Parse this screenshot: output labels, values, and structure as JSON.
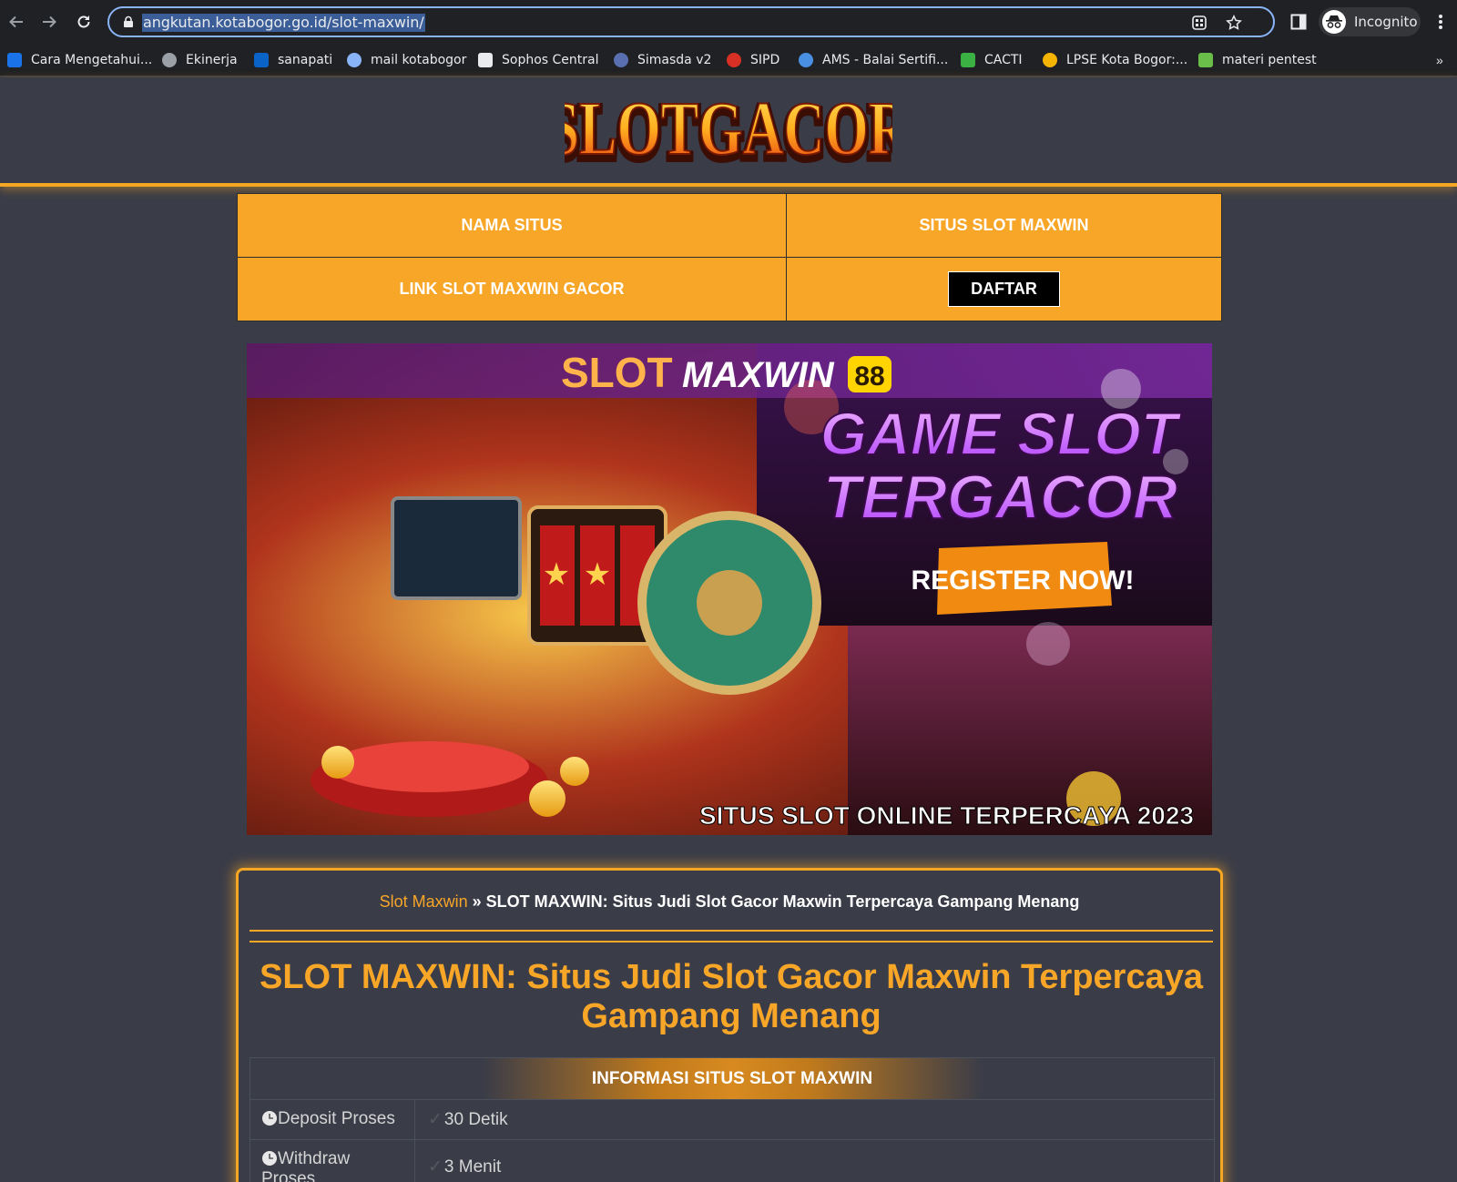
{
  "browser": {
    "url": "angkutan.kotabogor.go.id/slot-maxwin/",
    "profile_label": "Incognito",
    "more_bookmarks": "»"
  },
  "bookmarks": [
    {
      "label": "Cara Mengetahui...",
      "icon": "code-icon",
      "color": "#1a73e8"
    },
    {
      "label": "Ekinerja",
      "icon": "globe-icon",
      "color": "#9aa0a6"
    },
    {
      "label": "sanapati",
      "icon": "outlook-icon",
      "color": "#0a64c8"
    },
    {
      "label": "mail kotabogor",
      "icon": "chat-bubble-icon",
      "color": "#8ab4f8"
    },
    {
      "label": "Sophos Central",
      "icon": "sophos-icon",
      "color": "#e8eaed"
    },
    {
      "label": "Simasda v2",
      "icon": "emblem-icon",
      "color": "#5a6fb0"
    },
    {
      "label": "SIPD",
      "icon": "emblem-icon",
      "color": "#d93025"
    },
    {
      "label": "AMS - Balai Sertifi...",
      "icon": "ams-icon",
      "color": "#4a90e2"
    },
    {
      "label": "CACTI",
      "icon": "cacti-icon",
      "color": "#3bb143"
    },
    {
      "label": "LPSE Kota Bogor:...",
      "icon": "lpse-icon",
      "color": "#f4b400"
    },
    {
      "label": "materi pentest",
      "icon": "android-icon",
      "color": "#6abf4b"
    }
  ],
  "site": {
    "logo_text": "SLOTGACOR",
    "nav_table": {
      "r1c1": "NAMA SITUS",
      "r1c2": "SITUS SLOT MAXWIN",
      "r2c1": "LINK SLOT MAXWIN GACOR",
      "r2c2_button": "DAFTAR"
    },
    "banner": {
      "brand_a": "SLOT",
      "brand_b": "MAXWIN",
      "brand_num": "88",
      "headline_1": "GAME SLOT",
      "headline_2": "TERGACOR",
      "cta": "REGISTER NOW!",
      "footer": "SITUS SLOT ONLINE TERPERCAYA 2023"
    },
    "breadcrumb": {
      "link": "Slot Maxwin",
      "separator": "»",
      "current": "SLOT MAXWIN: Situs Judi Slot Gacor Maxwin Terpercaya Gampang Menang"
    },
    "title": "SLOT MAXWIN: Situs Judi Slot Gacor Maxwin Terpercaya Gampang Menang",
    "info": {
      "heading": "INFORMASI SITUS SLOT MAXWIN",
      "rows": [
        {
          "key": "Deposit Proses",
          "value": "30 Detik"
        },
        {
          "key": "Withdraw Proses",
          "value": "3 Menit"
        }
      ]
    }
  },
  "colors": {
    "accent": "#f8a628",
    "page_bg": "#3a3c48",
    "browser_bg": "#202124",
    "focus_ring": "#8ab4f8"
  }
}
